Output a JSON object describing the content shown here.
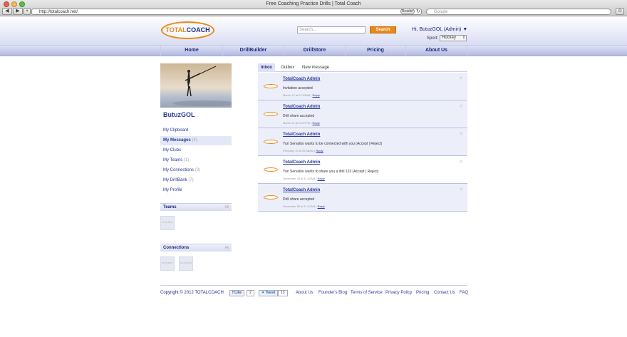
{
  "browser": {
    "window_title": "Free Coaching Practice Drills | Total Coach",
    "url": "http://totalcoach.net/",
    "reader_label": "Reader",
    "search_placeholder": "Google",
    "traffic_lights": [
      "#ec5f57",
      "#f6bd4f",
      "#58c33e"
    ]
  },
  "header": {
    "logo_total": "TOTAL",
    "logo_coach": "COACH",
    "search_placeholder": "Search...",
    "search_button": "Search",
    "greeting": "Hi, ButuzGOL (Admin) ▼",
    "sport_label": "Sport:",
    "sport_value": "Hockey"
  },
  "nav": [
    "Home",
    "DrillBuilder",
    "DrillStore",
    "Pricing",
    "About Us"
  ],
  "profile": {
    "username": "ButuzGOL"
  },
  "sidebar": [
    {
      "label": "My Clipboard",
      "count": ""
    },
    {
      "label": "My Messages",
      "count": "(4)"
    },
    {
      "label": "My Clubs",
      "count": ""
    },
    {
      "label": "My Teams",
      "count": "(1)"
    },
    {
      "label": "My Connections",
      "count": "(3)"
    },
    {
      "label": "My DrillBank",
      "count": "(7)"
    },
    {
      "label": "My Profile",
      "count": ""
    }
  ],
  "sections": {
    "teams_title": "Teams",
    "connections_title": "Connections",
    "all_label": "All",
    "no_photo": "NO PHOTO"
  },
  "tabs": [
    "Inbox",
    "Outbox",
    "New message"
  ],
  "messages": [
    {
      "sender": "TotalCoach Admin",
      "body": "Invitation accepted",
      "date": "March 12 at 07:03AM |",
      "action": "Reply"
    },
    {
      "sender": "TotalCoach Admin",
      "body": "Drill share accepted",
      "date": "March 12 at 03:07PM |",
      "action": "Reply"
    },
    {
      "sender": "TotalCoach Admin",
      "body": "Yuri Servatko wants to be connected with you (Accept | Reject)",
      "date": "February 15 at 05:48AM |",
      "action": "Reply"
    },
    {
      "sender": "TotalCoach Admin",
      "body": "Yuri Servatko wants to share you a drill 123 (Accept | Reject)",
      "date": "December 28 at 11:42AM |",
      "action": "Reply"
    },
    {
      "sender": "TotalCoach Admin",
      "body": "Drill share accepted",
      "date": "December 28 at 11:41AM |",
      "action": "Reply"
    }
  ],
  "footer": {
    "copyright": "Copyright © 2012 TOTALCOACH",
    "like_label": "Like",
    "like_count": "2",
    "tweet_label": "Tweet",
    "tweet_count": "13",
    "links": [
      "About Us",
      "Founder's Blog",
      "Terms of Service",
      "Privacy Policy",
      "Pricing",
      "Contact Us",
      "FAQ"
    ]
  }
}
